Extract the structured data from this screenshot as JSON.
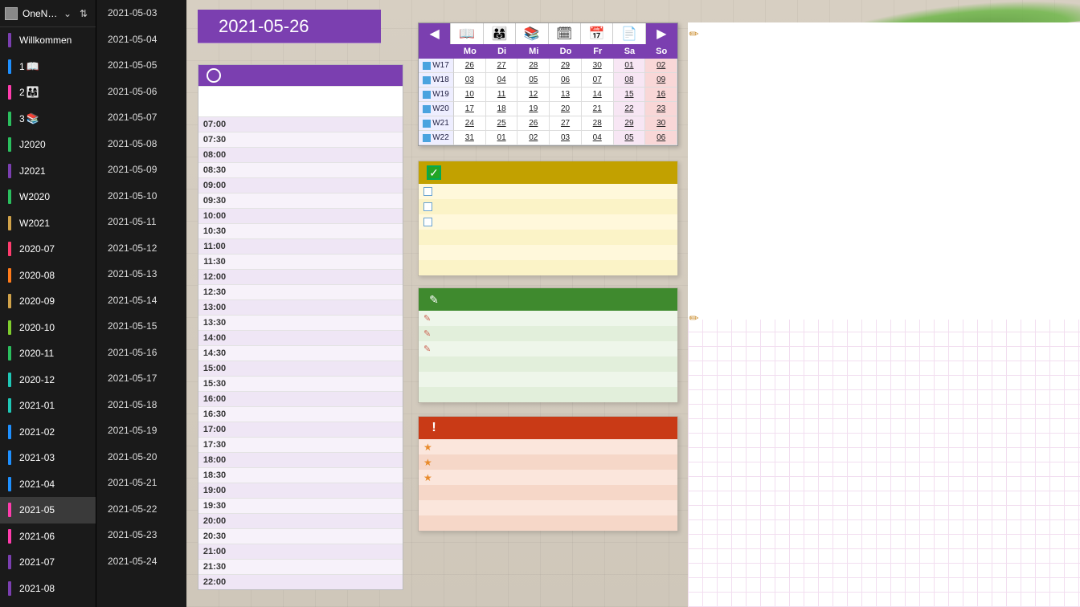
{
  "header": {
    "notebook_title": "OneNote Schulplaner…"
  },
  "page_title": "2021-05-26",
  "sections": [
    {
      "label": "Willkommen",
      "color": "#7b3fb0",
      "extra": ""
    },
    {
      "label": "1",
      "color": "#1e90ff",
      "extra": "📖"
    },
    {
      "label": "2",
      "color": "#ff3cac",
      "extra": "👨‍👩‍👧"
    },
    {
      "label": "3",
      "color": "#2bbf5e",
      "extra": "📚"
    },
    {
      "label": "J2020",
      "color": "#2bbf5e"
    },
    {
      "label": "J2021",
      "color": "#7b3fb0"
    },
    {
      "label": "W2020",
      "color": "#2bbf5e"
    },
    {
      "label": "W2021",
      "color": "#d0a24a"
    },
    {
      "label": "2020-07",
      "color": "#ff3c6e"
    },
    {
      "label": "2020-08",
      "color": "#ff7b1a"
    },
    {
      "label": "2020-09",
      "color": "#d0a24a"
    },
    {
      "label": "2020-10",
      "color": "#7fce2e"
    },
    {
      "label": "2020-11",
      "color": "#2bbf5e"
    },
    {
      "label": "2020-12",
      "color": "#1fc7b6"
    },
    {
      "label": "2021-01",
      "color": "#1fc7b6"
    },
    {
      "label": "2021-02",
      "color": "#1e90ff"
    },
    {
      "label": "2021-03",
      "color": "#1e90ff"
    },
    {
      "label": "2021-04",
      "color": "#1e90ff"
    },
    {
      "label": "2021-05",
      "color": "#ff3cac",
      "selected": true
    },
    {
      "label": "2021-06",
      "color": "#ff3cac"
    },
    {
      "label": "2021-07",
      "color": "#7b3fb0"
    },
    {
      "label": "2021-08",
      "color": "#7b3fb0"
    }
  ],
  "pages": [
    "2021-05-03",
    "2021-05-04",
    "2021-05-05",
    "2021-05-06",
    "2021-05-07",
    "2021-05-08",
    "2021-05-09",
    "2021-05-10",
    "2021-05-11",
    "2021-05-12",
    "2021-05-13",
    "2021-05-14",
    "2021-05-15",
    "2021-05-16",
    "2021-05-17",
    "2021-05-18",
    "2021-05-19",
    "2021-05-20",
    "2021-05-21",
    "2021-05-22",
    "2021-05-23",
    "2021-05-24"
  ],
  "times": [
    "07:00",
    "07:30",
    "08:00",
    "08:30",
    "09:00",
    "09:30",
    "10:00",
    "10:30",
    "11:00",
    "11:30",
    "12:00",
    "12:30",
    "13:00",
    "13:30",
    "14:00",
    "14:30",
    "15:00",
    "15:30",
    "16:00",
    "16:30",
    "17:00",
    "17:30",
    "18:00",
    "18:30",
    "19:00",
    "19:30",
    "20:00",
    "20:30",
    "21:00",
    "21:30",
    "22:00"
  ],
  "cal": {
    "toolbar": [
      "◀",
      "📖",
      "👨‍👩‍👧",
      "📚",
      "🗓",
      "📅",
      "📄",
      "▶"
    ],
    "days": [
      "Mo",
      "Di",
      "Mi",
      "Do",
      "Fr",
      "Sa",
      "So"
    ],
    "weeks": [
      {
        "wk": "W17",
        "d": [
          "26",
          "27",
          "28",
          "29",
          "30",
          "01",
          "02"
        ]
      },
      {
        "wk": "W18",
        "d": [
          "03",
          "04",
          "05",
          "06",
          "07",
          "08",
          "09"
        ]
      },
      {
        "wk": "W19",
        "d": [
          "10",
          "11",
          "12",
          "13",
          "14",
          "15",
          "16"
        ]
      },
      {
        "wk": "W20",
        "d": [
          "17",
          "18",
          "19",
          "20",
          "21",
          "22",
          "23"
        ]
      },
      {
        "wk": "W21",
        "d": [
          "24",
          "25",
          "26",
          "27",
          "28",
          "29",
          "30"
        ]
      },
      {
        "wk": "W22",
        "d": [
          "31",
          "01",
          "02",
          "03",
          "04",
          "05",
          "06"
        ]
      }
    ]
  },
  "todo_rows": 6,
  "notes_rows": 6,
  "alert_rows": 6
}
